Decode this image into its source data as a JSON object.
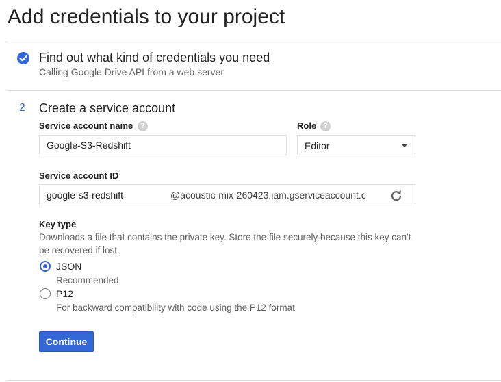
{
  "page": {
    "title": "Add credentials to your project"
  },
  "step1": {
    "title": "Find out what kind of credentials you need",
    "subtitle": "Calling Google Drive API from a web server",
    "icon": "check-circle-icon",
    "color": "#3367d6"
  },
  "step2": {
    "number": "2",
    "title": "Create a service account",
    "account_name": {
      "label": "Service account name",
      "value": "Google-S3-Redshift",
      "help_icon": "help-icon"
    },
    "role": {
      "label": "Role",
      "value": "Editor",
      "help_icon": "help-icon"
    },
    "account_id": {
      "label": "Service account ID",
      "value": "google-s3-redshift",
      "suffix": "@acoustic-mix-260423.iam.gserviceaccount.c",
      "refresh_icon": "refresh-icon"
    },
    "key_type": {
      "label": "Key type",
      "description": "Downloads a file that contains the private key. Store the file securely because this key can't be recovered if lost.",
      "options": [
        {
          "label": "JSON",
          "sub": "Recommended",
          "selected": true
        },
        {
          "label": "P12",
          "sub": "For backward compatibility with code using the P12 format",
          "selected": false
        }
      ]
    },
    "continue_label": "Continue"
  },
  "colors": {
    "accent": "#3367d6",
    "divider": "#dadada",
    "muted_text": "#616161"
  }
}
